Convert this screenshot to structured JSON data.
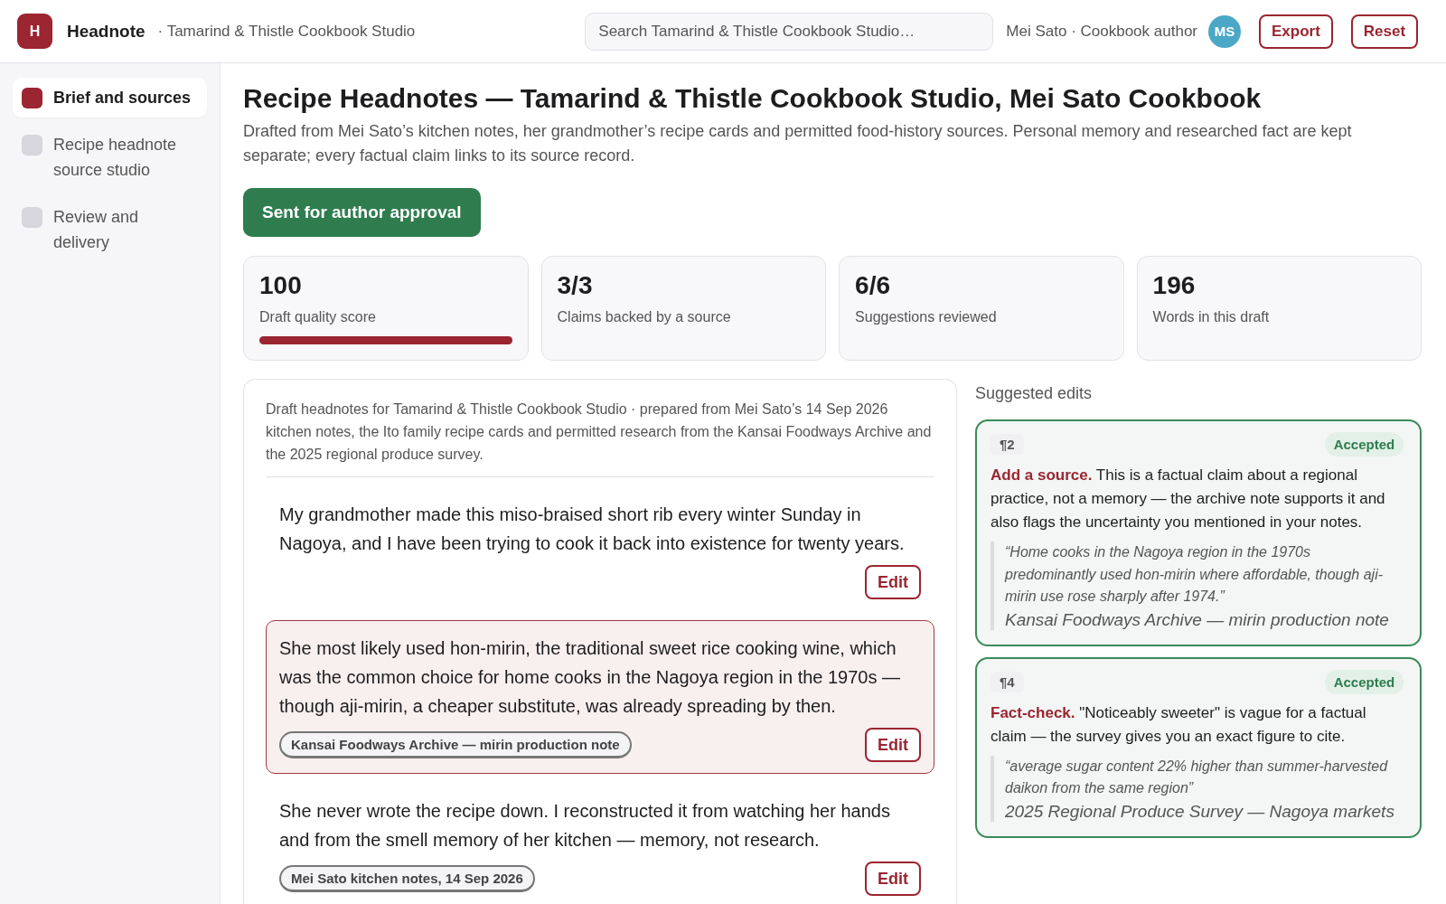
{
  "app": {
    "logo": "H",
    "name": "Headnote",
    "workspace": "· Tamarind & Thistle Cookbook Studio"
  },
  "search": {
    "placeholder": "Search Tamarind & Thistle Cookbook Studio…"
  },
  "user": {
    "name": "Mei Sato · Cookbook author",
    "initials": "MS"
  },
  "header_buttons": [
    "Export",
    "Reset"
  ],
  "sidebar": {
    "items": [
      {
        "label": "Brief and sources",
        "selected": true
      },
      {
        "label": "Recipe headnote source studio",
        "selected": false
      },
      {
        "label": "Review and delivery",
        "selected": false
      }
    ]
  },
  "page": {
    "title": "Recipe Headnotes — Tamarind & Thistle Cookbook Studio, Mei Sato Cookbook",
    "description": "Drafted from Mei Sato’s kitchen notes, her grandmother’s recipe cards and permitted food-history sources. Personal memory and researched fact are kept separate; every factual claim links to its source record.",
    "status_button": "Sent for author approval"
  },
  "stats": [
    {
      "value": "100",
      "label": "Draft quality score",
      "level": 1.0
    },
    {
      "value": "3/3",
      "label": "Claims backed by a source"
    },
    {
      "value": "6/6",
      "label": "Suggestions reviewed"
    },
    {
      "value": "196",
      "label": "Words in this draft"
    }
  ],
  "draft": {
    "intro": "Draft headnotes for Tamarind & Thistle Cookbook Studio · prepared from Mei Sato’s 14 Sep 2026 kitchen notes, the Ito family recipe cards and permitted research from the Kansai Foodways Archive and the 2025 regional produce survey.",
    "paragraphs": [
      {
        "text": "My grandmother made this miso-braised short rib every winter Sunday in Nagoya, and I have been trying to cook it back into existence for twenty years.",
        "highlighted": false,
        "button": "Edit"
      },
      {
        "text": "She most likely used hon-mirin, the traditional sweet rice cooking wine, which was the common choice for home cooks in the Nagoya region in the 1970s — though aji-mirin, a cheaper substitute, was already spreading by then.",
        "highlighted": true,
        "source": "Kansai Foodways Archive — mirin production note",
        "button": "Edit"
      },
      {
        "text": "She never wrote the recipe down. I reconstructed it from watching her hands and from the smell memory of her kitchen — memory, not research.",
        "highlighted": false,
        "source": "Mei Sato kitchen notes, 14 Sep 2026",
        "button": "Edit"
      }
    ]
  },
  "suggestions": {
    "heading": "Suggested edits",
    "items": [
      {
        "paragraph": "¶2",
        "status": "Accepted",
        "text": "**Add a source.** This is a factual claim about a regional practice, not a memory — the archive note supports it and also flags the uncertainty you mentioned in your notes.",
        "quote": "“Home cooks in the Nagoya region in the 1970s predominantly used hon-mirin where affordable, though aji-mirin use rose sharply after 1974.”",
        "source": "Kansai Foodways Archive — mirin production note"
      },
      {
        "paragraph": "¶4",
        "status": "Accepted",
        "text": "**Fact-check.** \"Noticeably sweeter\" is vague for a factual claim — the survey gives you an exact figure to cite.",
        "quote": "“average sugar content 22% higher than summer-harvested daikon from the same region”",
        "source": "2025 Regional Produce Survey — Nagoya markets"
      }
    ]
  }
}
